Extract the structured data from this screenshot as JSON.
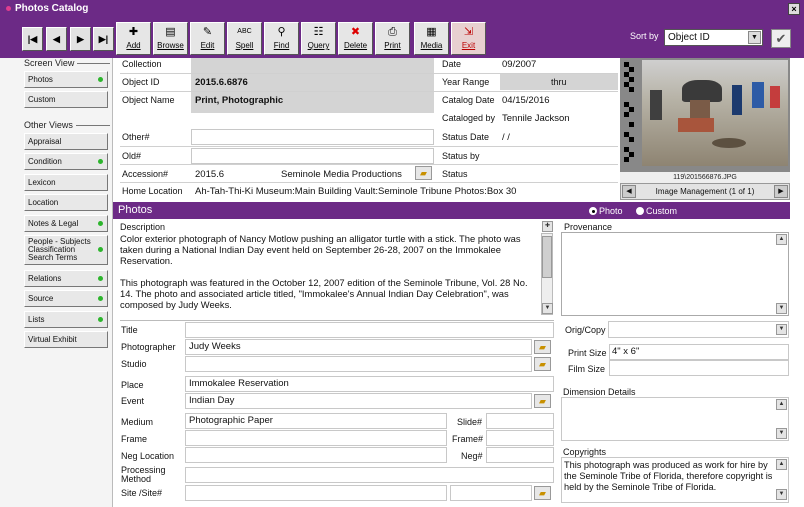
{
  "window": {
    "title": "Photos Catalog",
    "close": "×"
  },
  "toolbar": {
    "nav": [
      "|◀",
      "◀",
      "▶",
      "▶|"
    ],
    "buttons": [
      {
        "label": "Add",
        "icon": "✚"
      },
      {
        "label": "Browse",
        "icon": "▤"
      },
      {
        "label": "Edit",
        "icon": "✎"
      },
      {
        "label": "Spell",
        "icon": "ABC"
      },
      {
        "label": "Find",
        "icon": "⚲"
      },
      {
        "label": "Query",
        "icon": "☷"
      },
      {
        "label": "Delete",
        "icon": "✖"
      },
      {
        "label": "Print",
        "icon": "⎙"
      },
      {
        "label": "Media",
        "icon": "▦"
      },
      {
        "label": "Exit",
        "icon": "⇲"
      }
    ],
    "sort_label": "Sort by",
    "sort_value": "Object ID",
    "sort_arrow": "▼",
    "check": "✔"
  },
  "left": {
    "screen_view_label": "Screen View",
    "screen_views": [
      "Photos",
      "Custom"
    ],
    "other_views_label": "Other Views",
    "other_views": [
      {
        "label": "Appraisal",
        "dot": false
      },
      {
        "label": "Condition",
        "dot": true
      },
      {
        "label": "Lexicon",
        "dot": false
      },
      {
        "label": "Location",
        "dot": false
      },
      {
        "label": "Notes & Legal",
        "dot": true
      },
      {
        "label": "People - Subjects Classification Search Terms",
        "dot": true
      },
      {
        "label": "Relations",
        "dot": true
      },
      {
        "label": "Source",
        "dot": true
      },
      {
        "label": "Lists",
        "dot": true
      },
      {
        "label": "Virtual Exhibit",
        "dot": false
      }
    ]
  },
  "header": {
    "collection_label": "Collection",
    "collection": "",
    "object_id_label": "Object ID",
    "object_id": "2015.6.6876",
    "object_name_label": "Object Name",
    "object_name": "Print, Photographic",
    "other_label": "Other#",
    "old_label": "Old#",
    "accession_label": "Accession#",
    "accession": "2015.6",
    "accession_source": "Seminole Media Productions",
    "home_location_label": "Home Location",
    "home_location": "Ah-Tah-Thi-Ki Museum:Main Building Vault:Seminole Tribune Photos:Box 30"
  },
  "dates": {
    "date_label": "Date",
    "date": "09/2007",
    "year_range_label": "Year Range",
    "thru": "thru",
    "catalog_date_label": "Catalog Date",
    "catalog_date": "04/15/2016",
    "cataloged_by_label": "Cataloged by",
    "cataloged_by": "Tennile Jackson",
    "status_date_label": "Status Date",
    "status_date": " /  /",
    "status_by_label": "Status by",
    "status_label": "Status"
  },
  "image": {
    "filename": "119\\201566876.JPG",
    "manager": "Image Management (1 of 1)",
    "prev": "◀",
    "next": "▶"
  },
  "section": {
    "title": "Photos",
    "radio_photo": "Photo",
    "radio_custom": "Custom"
  },
  "description": {
    "label": "Description",
    "p1": "Color exterior photograph of Nancy Motlow pushing an alligator turtle with a stick. The photo was taken during a National Indian Day event held on September 26-28, 2007 on the Immokalee Reservation.",
    "p2": "This photograph was featured in the October 12, 2007 edition of the Seminole Tribune, Vol. 28 No. 14. The photo and associated article titled, \"Immokalee's Annual Indian Day Celebration\", was composed by Judy Weeks."
  },
  "fields": {
    "title_label": "Title",
    "photographer_label": "Photographer",
    "photographer": "Judy Weeks",
    "studio_label": "Studio",
    "place_label": "Place",
    "place": "Immokalee Reservation",
    "event_label": "Event",
    "event": "Indian Day",
    "medium_label": "Medium",
    "medium": "Photographic Paper",
    "slide_label": "Slide#",
    "frame_label": "Frame",
    "frame2_label": "Frame#",
    "neg_location_label": "Neg Location",
    "neg_label": "Neg#",
    "processing_label": "Processing Method",
    "site_label": "Site /Site#"
  },
  "right": {
    "provenance_label": "Provenance",
    "orig_copy_label": "Orig/Copy",
    "print_size_label": "Print Size",
    "print_size": "4\" x 6\"",
    "film_size_label": "Film Size",
    "dimension_label": "Dimension Details",
    "copyrights_label": "Copyrights",
    "copyrights": "This photograph was produced as work for hire by the Seminole Tribe of Florida, therefore copyright is held by the Seminole Tribe of Florida."
  }
}
